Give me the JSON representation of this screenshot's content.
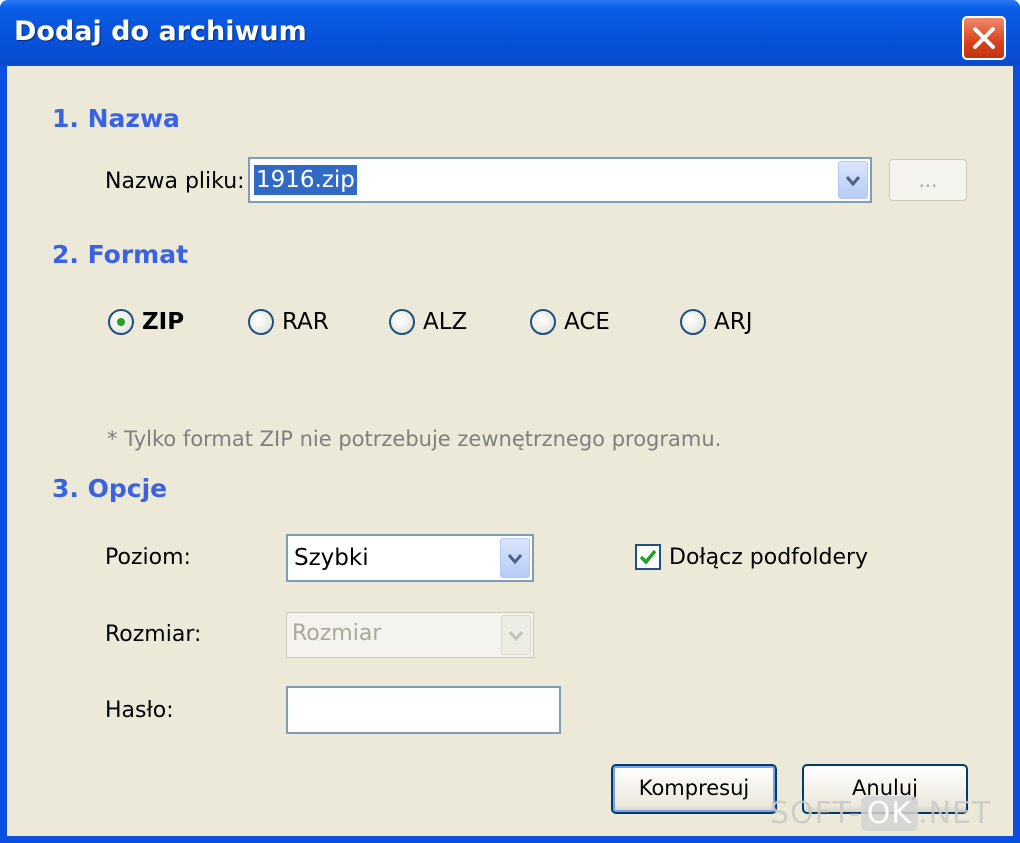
{
  "window": {
    "title": "Dodaj do archiwum"
  },
  "sections": {
    "name": "1. Nazwa",
    "format": "2. Format",
    "options": "3. Opcje"
  },
  "name_section": {
    "filename_label": "Nazwa pliku:",
    "filename_value": "1916.zip",
    "browse_label": "..."
  },
  "format_section": {
    "options": [
      "ZIP",
      "RAR",
      "ALZ",
      "ACE",
      "ARJ"
    ],
    "selected": "ZIP",
    "note": "* Tylko format ZIP nie potrzebuje zewnętrznego programu."
  },
  "options_section": {
    "level_label": "Poziom:",
    "level_value": "Szybki",
    "size_label": "Rozmiar:",
    "size_value": "Rozmiar",
    "password_label": "Hasło:",
    "password_value": "",
    "subfolders_label": "Dołącz podfoldery",
    "subfolders_checked": true
  },
  "buttons": {
    "compress": "Kompresuj",
    "cancel": "Anuluj"
  },
  "watermark": {
    "left": "SOFT-",
    "middle": "OK",
    "right": ".NET"
  },
  "colors": {
    "section_heading": "#3b62e0",
    "titlebar": "#0851d8",
    "client_bg": "#ece9d8",
    "selection": "#316ac5"
  }
}
